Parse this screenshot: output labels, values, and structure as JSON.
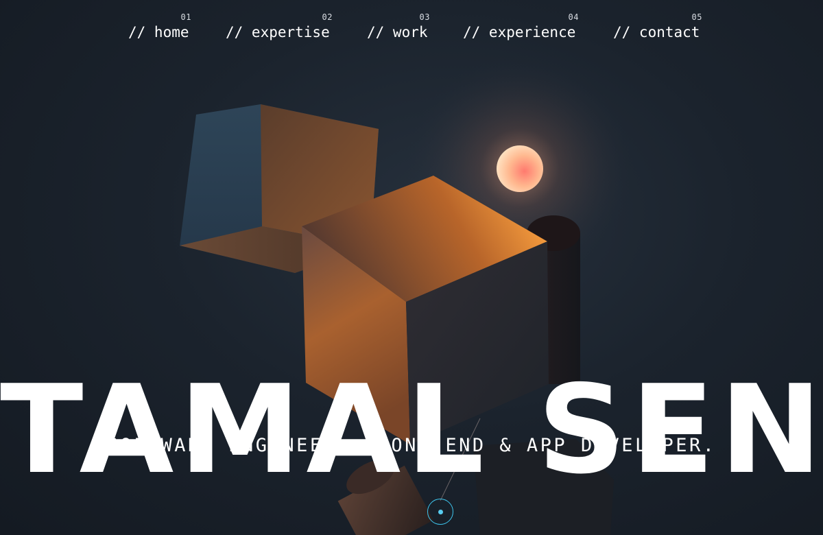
{
  "nav": {
    "items": [
      {
        "number": "01",
        "label": "// home"
      },
      {
        "number": "02",
        "label": "// expertise"
      },
      {
        "number": "03",
        "label": "// work"
      },
      {
        "number": "04",
        "label": "// experience"
      },
      {
        "number": "05",
        "label": "// contact"
      }
    ]
  },
  "hero": {
    "name": "TAMAL SEN",
    "tagline": "SOFTWARE ENGINEER, FRONT END & APP DEVELOPER."
  },
  "colors": {
    "background": "#161d26",
    "text": "#ffffff",
    "accent": "#3ec6ee",
    "glow": "#ff8a5c"
  },
  "icons": {
    "scroll": "scroll-down-icon"
  }
}
